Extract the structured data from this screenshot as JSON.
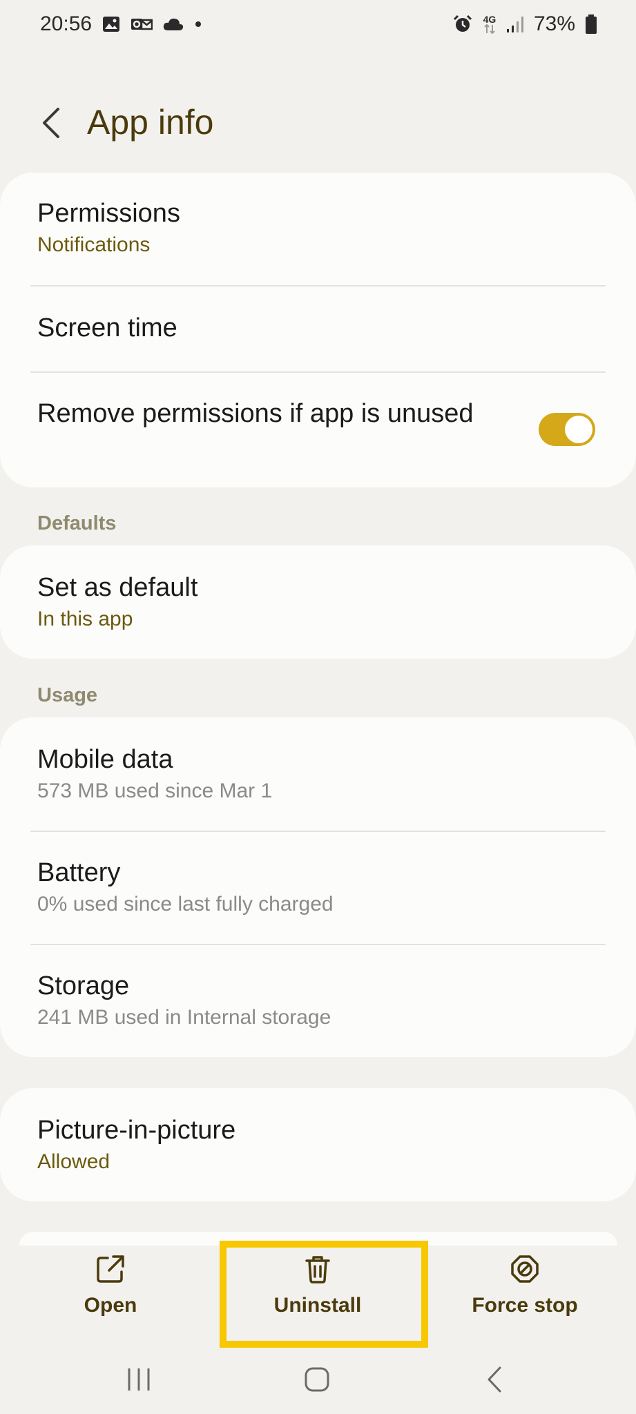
{
  "status_bar": {
    "time": "20:56",
    "network": "4G",
    "battery": "73%",
    "icons": [
      "image-icon",
      "outlook-icon",
      "cloud-icon",
      "dot-icon",
      "alarm-icon",
      "signal-icon",
      "battery-icon"
    ]
  },
  "header": {
    "title": "App info",
    "back_icon": "chevron-left-icon"
  },
  "cards": {
    "permissions": {
      "title": "Permissions",
      "subtitle": "Notifications"
    },
    "screen_time": {
      "title": "Screen time"
    },
    "remove_permissions": {
      "title": "Remove permissions if app is unused",
      "toggle_on": true
    }
  },
  "sections": {
    "defaults": "Defaults",
    "usage": "Usage"
  },
  "defaults": {
    "set_default": {
      "title": "Set as default",
      "subtitle": "In this app"
    }
  },
  "usage": {
    "mobile_data": {
      "title": "Mobile data",
      "subtitle": "573 MB used since Mar 1"
    },
    "battery": {
      "title": "Battery",
      "subtitle": "0% used since last fully charged"
    },
    "storage": {
      "title": "Storage",
      "subtitle": "241 MB used in Internal storage"
    }
  },
  "pip": {
    "title": "Picture-in-picture",
    "subtitle": "Allowed"
  },
  "actions": {
    "open": "Open",
    "uninstall": "Uninstall",
    "force_stop": "Force stop"
  },
  "colors": {
    "accent": "#d4a819",
    "title": "#4b3a0d",
    "highlight": "#f7c800",
    "background": "#f2f1ed"
  }
}
